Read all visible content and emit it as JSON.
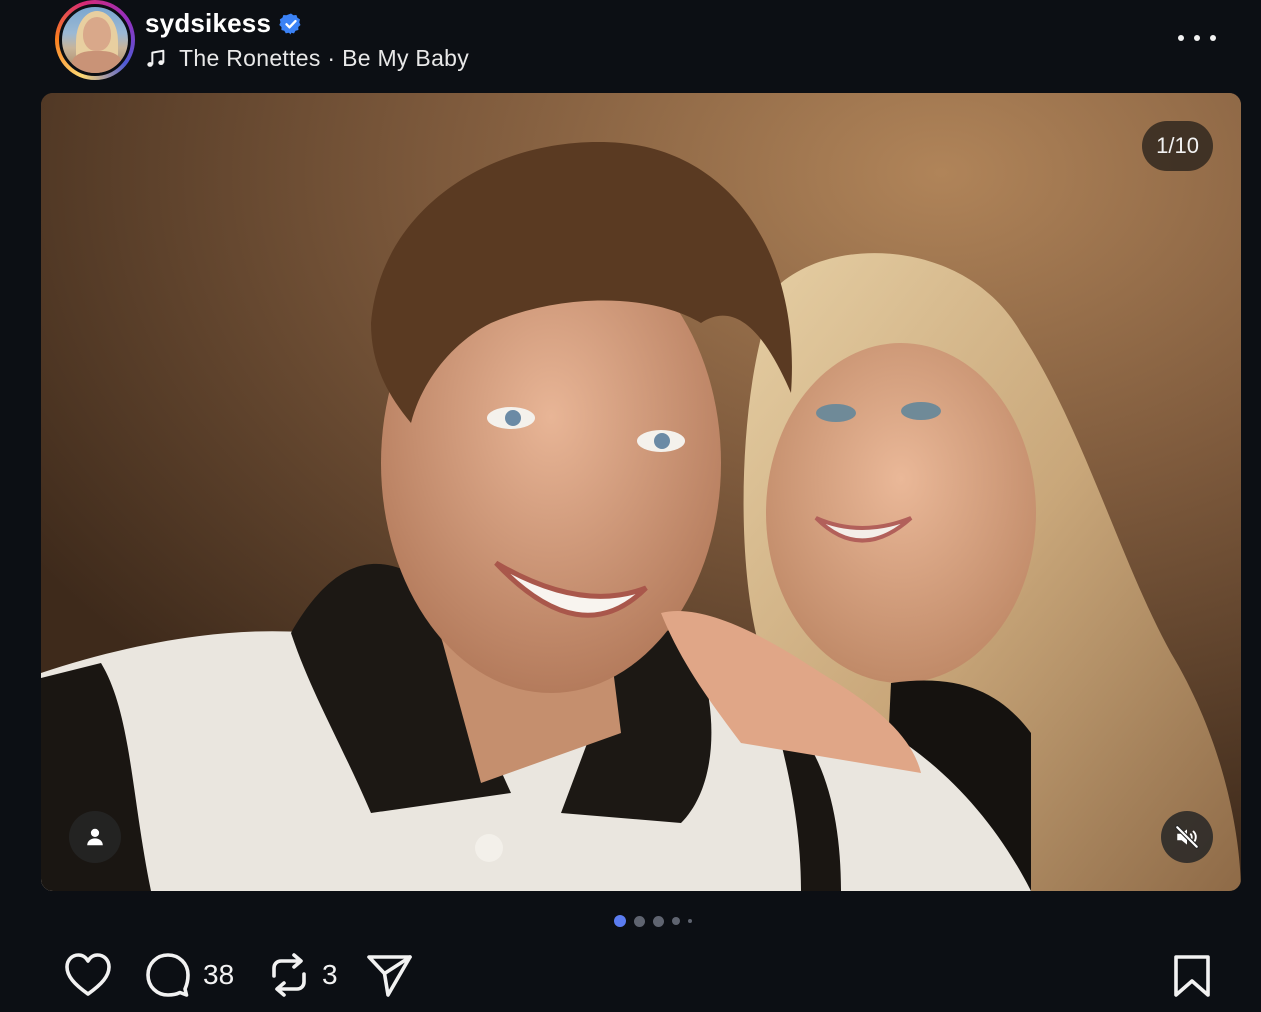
{
  "header": {
    "username": "sydsikess",
    "verified": true,
    "music_artist": "The Ronettes",
    "music_separator": "·",
    "music_title": "Be My Baby"
  },
  "media": {
    "counter": "1/10",
    "current_index": 1,
    "total": 10
  },
  "actions": {
    "comments_count": "38",
    "reposts_count": "3"
  },
  "colors": {
    "background": "#0c0f14",
    "verified": "#3b82f6",
    "active_dot": "#5b7cf0",
    "inactive_dot": "#5f6470"
  },
  "icons": {
    "more": "more-horizontal-icon",
    "music": "music-note-icon",
    "like": "heart-icon",
    "comment": "comment-icon",
    "repost": "repost-icon",
    "share": "send-icon",
    "save": "bookmark-icon",
    "tag": "user-icon",
    "mute": "volume-off-icon"
  }
}
